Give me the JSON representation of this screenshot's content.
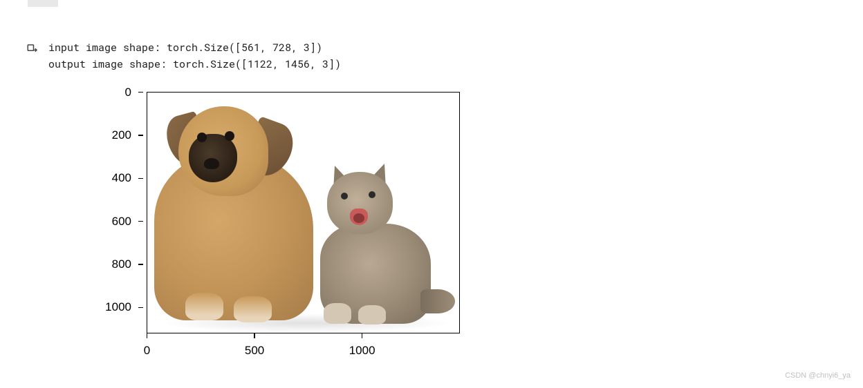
{
  "output": {
    "line1": "input image shape: torch.Size([561, 728, 3])",
    "line2": "output image shape: torch.Size([1122, 1456, 3])"
  },
  "chart_data": {
    "type": "image",
    "description": "matplotlib imshow of upsampled image showing a dog and cat",
    "image_dims": [
      1122,
      1456
    ],
    "x_ticks": [
      0,
      500,
      1000
    ],
    "y_ticks": [
      0,
      200,
      400,
      600,
      800,
      1000
    ],
    "xlim": [
      0,
      1456
    ],
    "ylim": [
      1122,
      0
    ]
  },
  "watermark": "CSDN @chnyi6_ya",
  "icons": {
    "output_marker": "output-arrow-icon"
  }
}
